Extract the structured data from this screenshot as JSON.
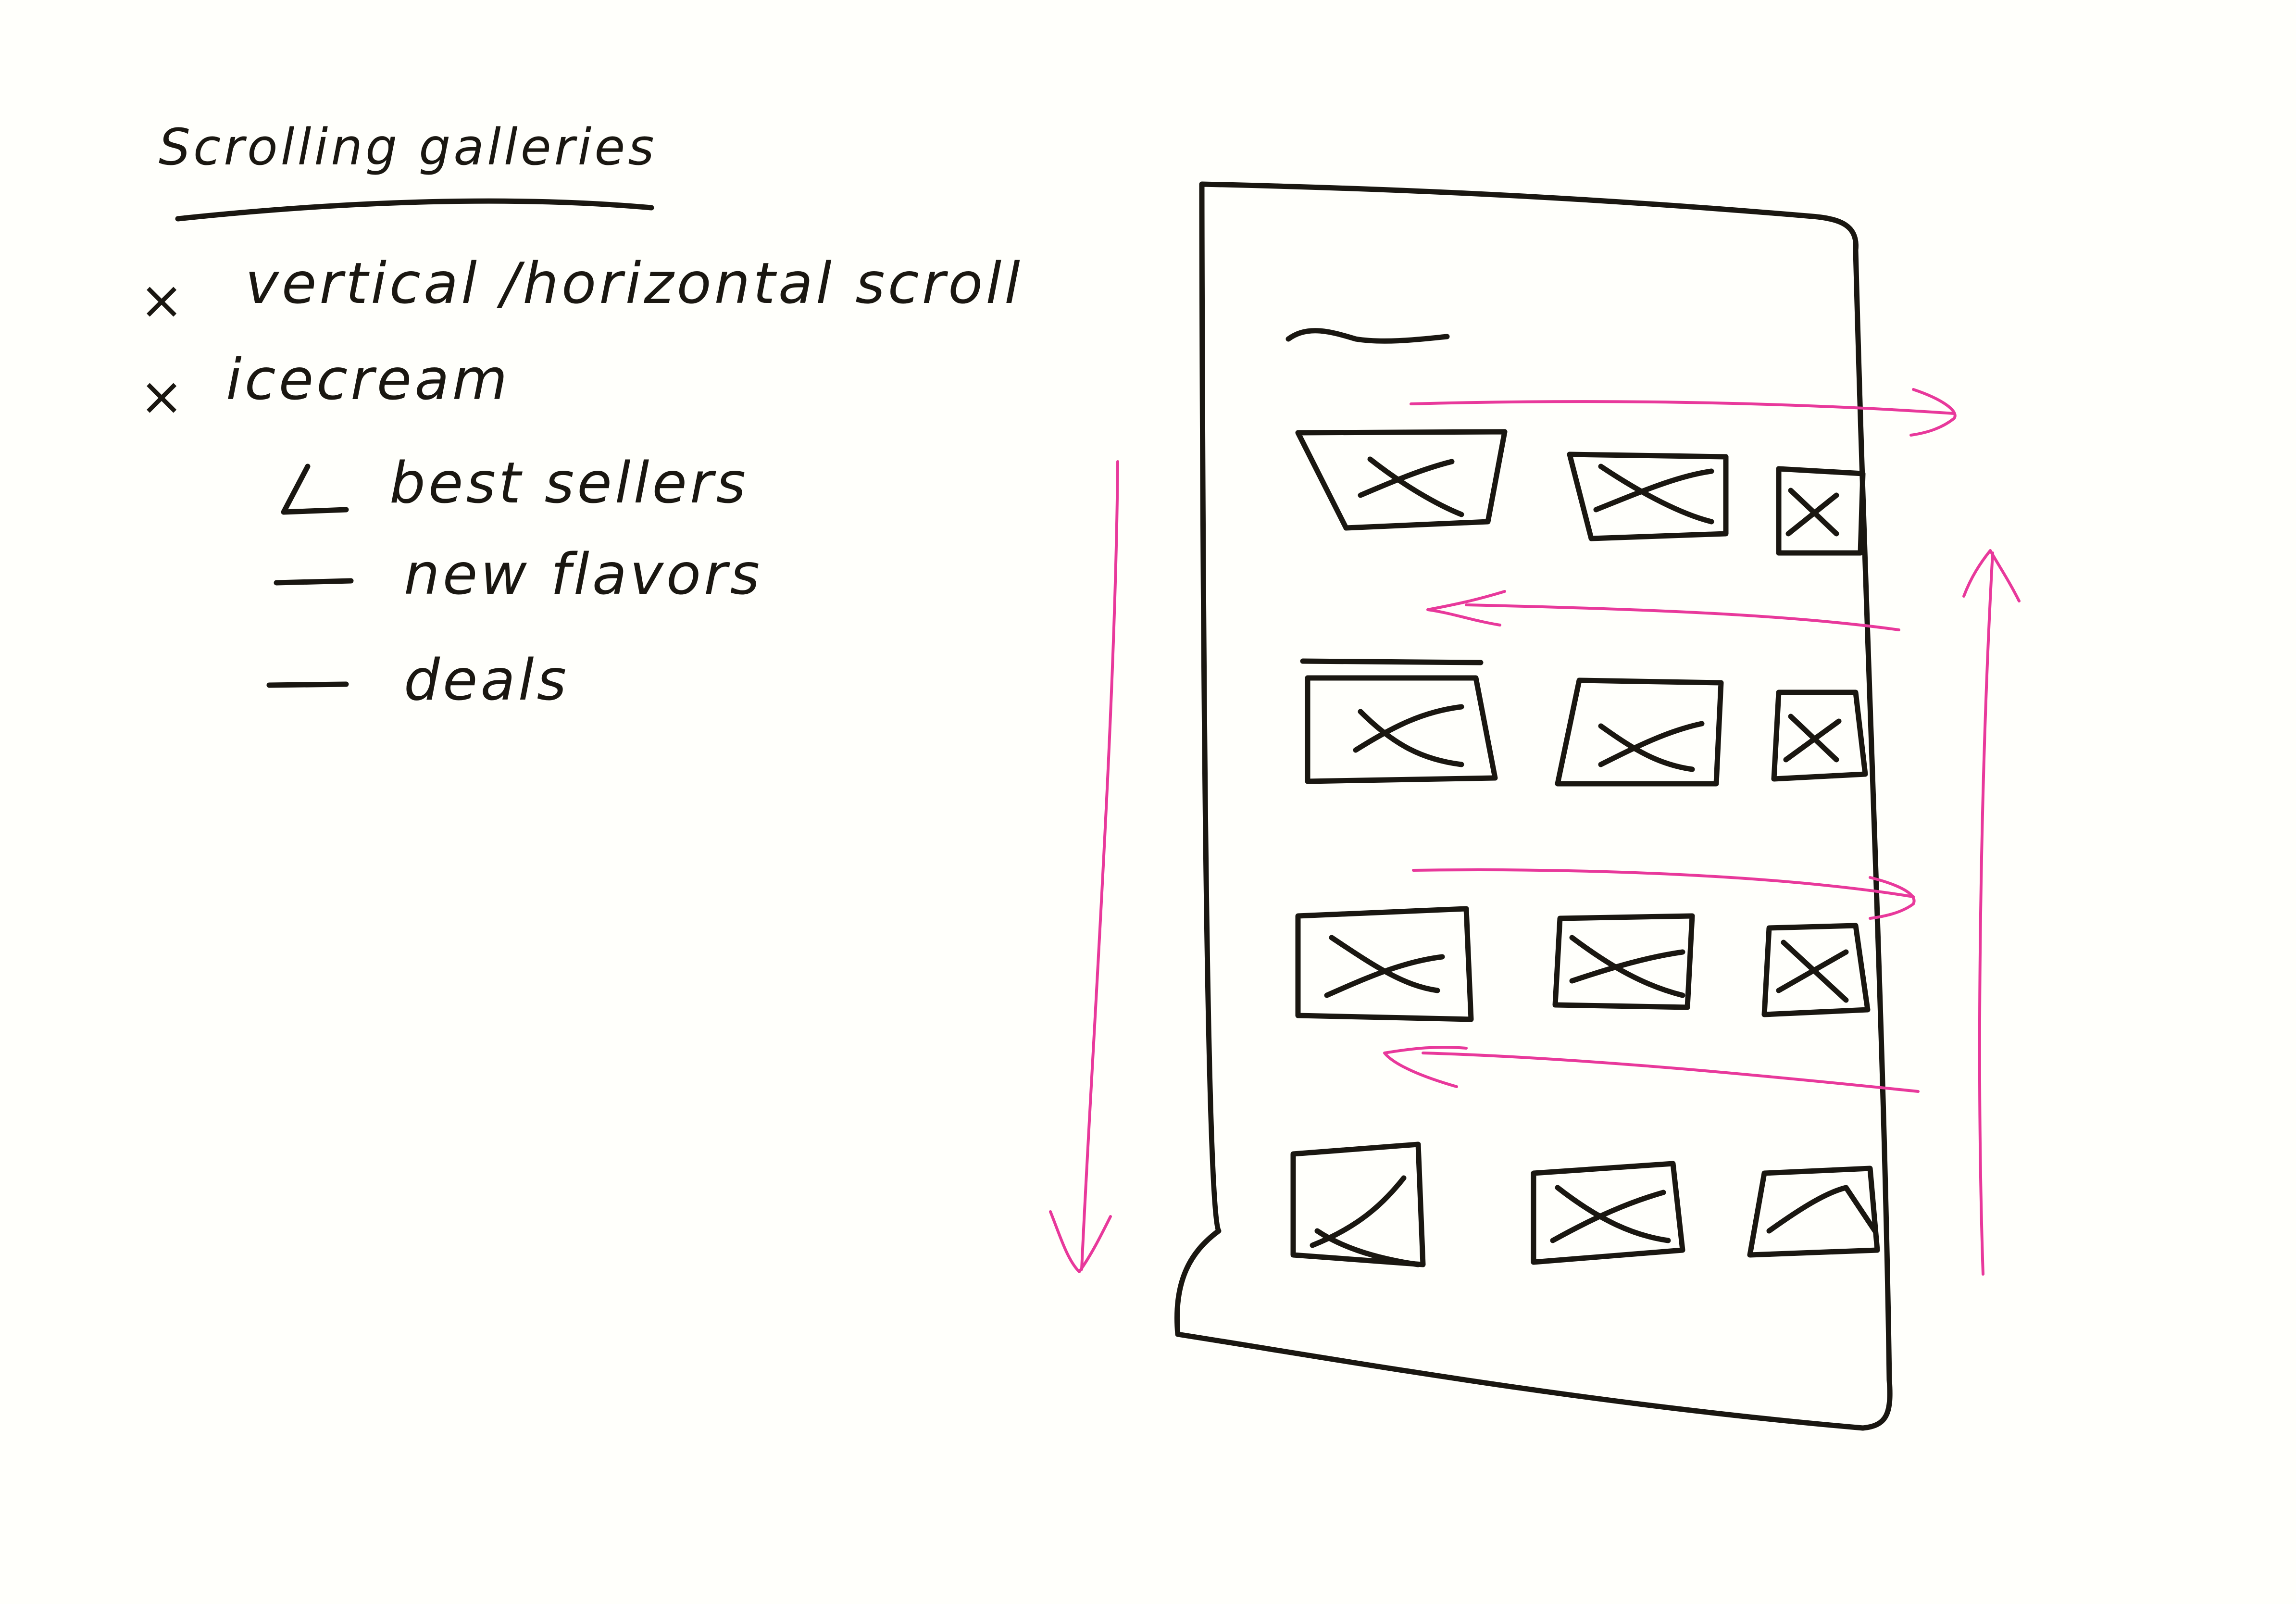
{
  "notes": {
    "title": "Scrolling galleries",
    "items": [
      {
        "marker": "×",
        "label": "vertical /horizontal scroll"
      },
      {
        "marker": "×",
        "label": "icecream"
      }
    ],
    "subitems": [
      {
        "label": "best sellers"
      },
      {
        "label": "new flavors"
      },
      {
        "label": "deals"
      }
    ]
  },
  "wireframe": {
    "rows": 4,
    "tiles_per_row": 3
  },
  "colors": {
    "ink": "#1a1711",
    "arrow": "#e8399b",
    "paper": "#fffffb"
  },
  "icons": {
    "tile": "image-placeholder-icon",
    "scroll": "arrow-icon"
  }
}
